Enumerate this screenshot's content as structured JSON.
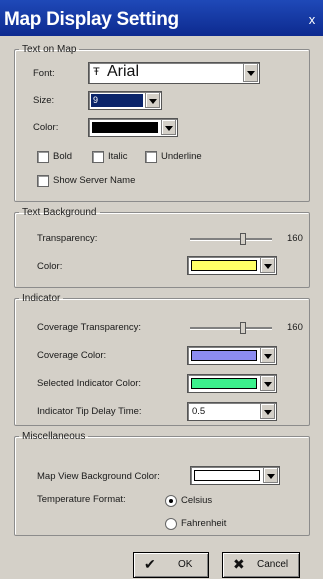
{
  "window": {
    "title": "Map Display Setting",
    "close_glyph": "x"
  },
  "text_on_map": {
    "legend": "Text on Map",
    "font_label": "Font:",
    "font_icon": "Ŧ",
    "font_value": "Arial",
    "size_label": "Size:",
    "size_value": "9",
    "color_label": "Color:",
    "color_value": "#000000",
    "bold_label": "Bold",
    "italic_label": "Italic",
    "underline_label": "Underline",
    "show_server_label": "Show Server Name"
  },
  "text_background": {
    "legend": "Text Background",
    "transparency_label": "Transparency:",
    "transparency_value": "160",
    "transparency_fraction": 0.63,
    "color_label": "Color:",
    "color_value": "#ffff66"
  },
  "indicator": {
    "legend": "Indicator",
    "coverage_transparency_label": "Coverage Transparency:",
    "coverage_transparency_value": "160",
    "coverage_transparency_fraction": 0.63,
    "coverage_color_label": "Coverage Color:",
    "coverage_color_value": "#8c8cf0",
    "selected_color_label": "Selected Indicator Color:",
    "selected_color_value": "#3cf08c",
    "tip_delay_label": "Indicator Tip Delay Time:",
    "tip_delay_value": "0.5"
  },
  "misc": {
    "legend": "Miscellaneous",
    "bg_color_label": "Map View Background Color:",
    "bg_color_value": "#ffffff",
    "temp_label": "Temperature Format:",
    "celsius_label": "Celsius",
    "fahrenheit_label": "Fahrenheit",
    "selected_format": "Celsius"
  },
  "buttons": {
    "ok_label": "OK",
    "ok_icon": "✔",
    "cancel_label": "Cancel",
    "cancel_icon": "✖"
  }
}
